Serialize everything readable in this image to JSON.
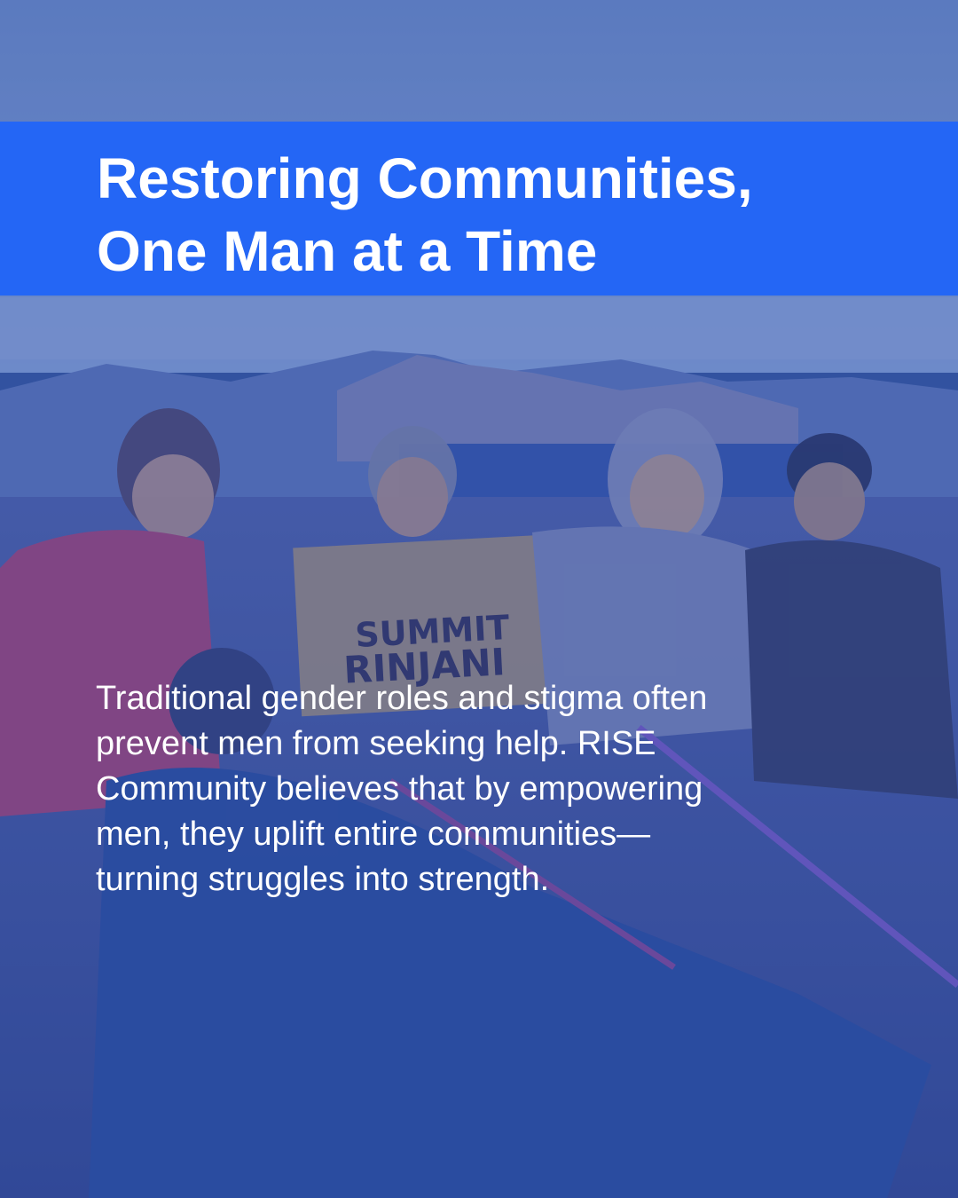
{
  "post": {
    "title_lines": [
      "Restoring Communities,",
      "One Man at a Time"
    ],
    "body_lines": [
      "Traditional gender roles and stigma often",
      "prevent men from seeking help. RISE",
      "Community believes that by empowering",
      "men, they uplift entire communities—",
      "turning struggles into strength."
    ]
  },
  "photo": {
    "sign_lines": [
      "SUMMIT",
      "RINJANI"
    ]
  },
  "colors": {
    "title_band": "#2466f5",
    "overlay": "#2346aa",
    "text": "#ffffff"
  }
}
